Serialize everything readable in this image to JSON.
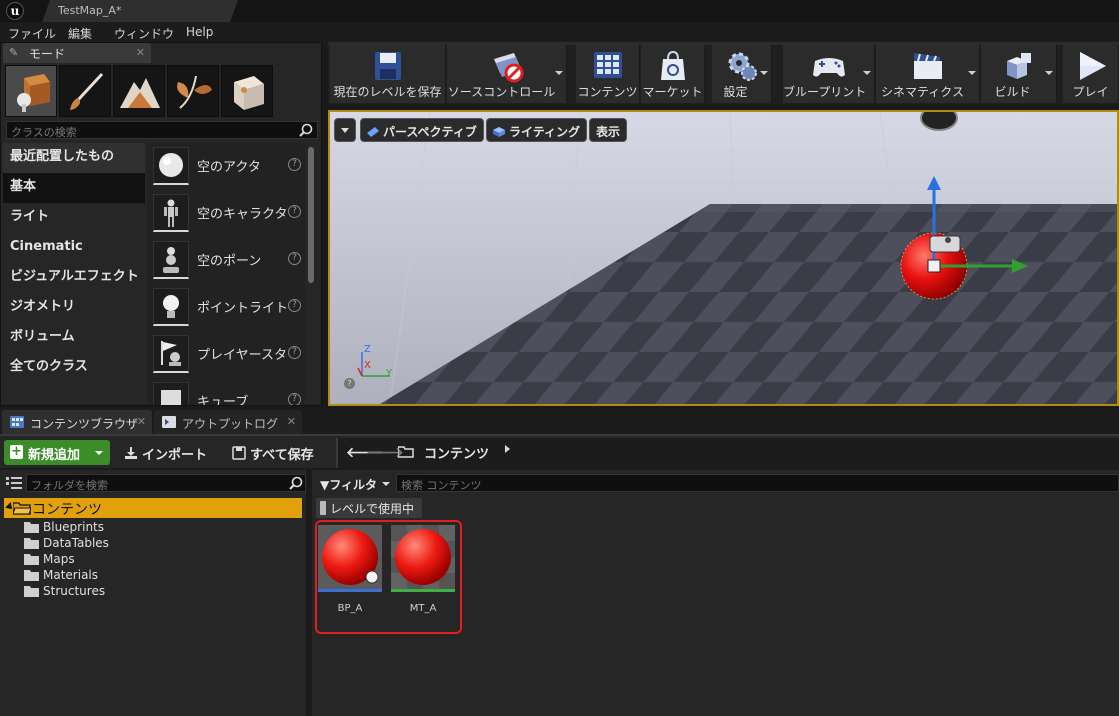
{
  "window": {
    "tab_title": "TestMap_A*"
  },
  "menu": [
    "ファイル",
    "編集",
    "ウィンドウ",
    "Help"
  ],
  "modes": {
    "tab_label": "モード",
    "search_placeholder": "クラスの検索",
    "categories": [
      "最近配置したもの",
      "基本",
      "ライト",
      "Cinematic",
      "ビジュアルエフェクト",
      "ジオメトリ",
      "ボリューム",
      "全てのクラス"
    ],
    "selected_category": "基本",
    "items": [
      "空のアクタ",
      "空のキャラクタ",
      "空のポーン",
      "ポイントライト",
      "プレイヤースタ",
      "キューブ"
    ]
  },
  "toolbar": {
    "save_level": "現在のレベルを保存",
    "source_control": "ソースコントロール",
    "content": "コンテンツ",
    "marketplace": "マーケット",
    "settings": "設定",
    "blueprints": "ブループリント",
    "cinematics": "シネマティクス",
    "build": "ビルド",
    "play": "プレイ"
  },
  "viewport": {
    "perspective": "パースペクティブ",
    "lighting": "ライティング",
    "show": "表示",
    "axis_z": "Z",
    "axis_x": "X",
    "axis_y": "Y"
  },
  "content_browser": {
    "tab_label": "コンテンツブラウザ",
    "output_tab_label": "アウトプットログ",
    "add_new": "新規追加",
    "import": "インポート",
    "save_all": "すべて保存",
    "path": "コンテンツ",
    "folder_search_placeholder": "フォルダを検索",
    "root_folder": "コンテンツ",
    "folders": [
      "Blueprints",
      "DataTables",
      "Maps",
      "Materials",
      "Structures"
    ],
    "filter_label": "フィルタ",
    "asset_search_placeholder": "検索 コンテンツ",
    "level_filter": "レベルで使用中",
    "assets": [
      {
        "name": "BP_A",
        "type_color": "#3a6fd8"
      },
      {
        "name": "MT_A",
        "type_color": "#3cb043"
      }
    ]
  },
  "colors": {
    "accent_folder": "#e1a10d",
    "add_button": "#3b8d2a",
    "viewport_border": "#b38a12",
    "highlight": "#e02020"
  }
}
